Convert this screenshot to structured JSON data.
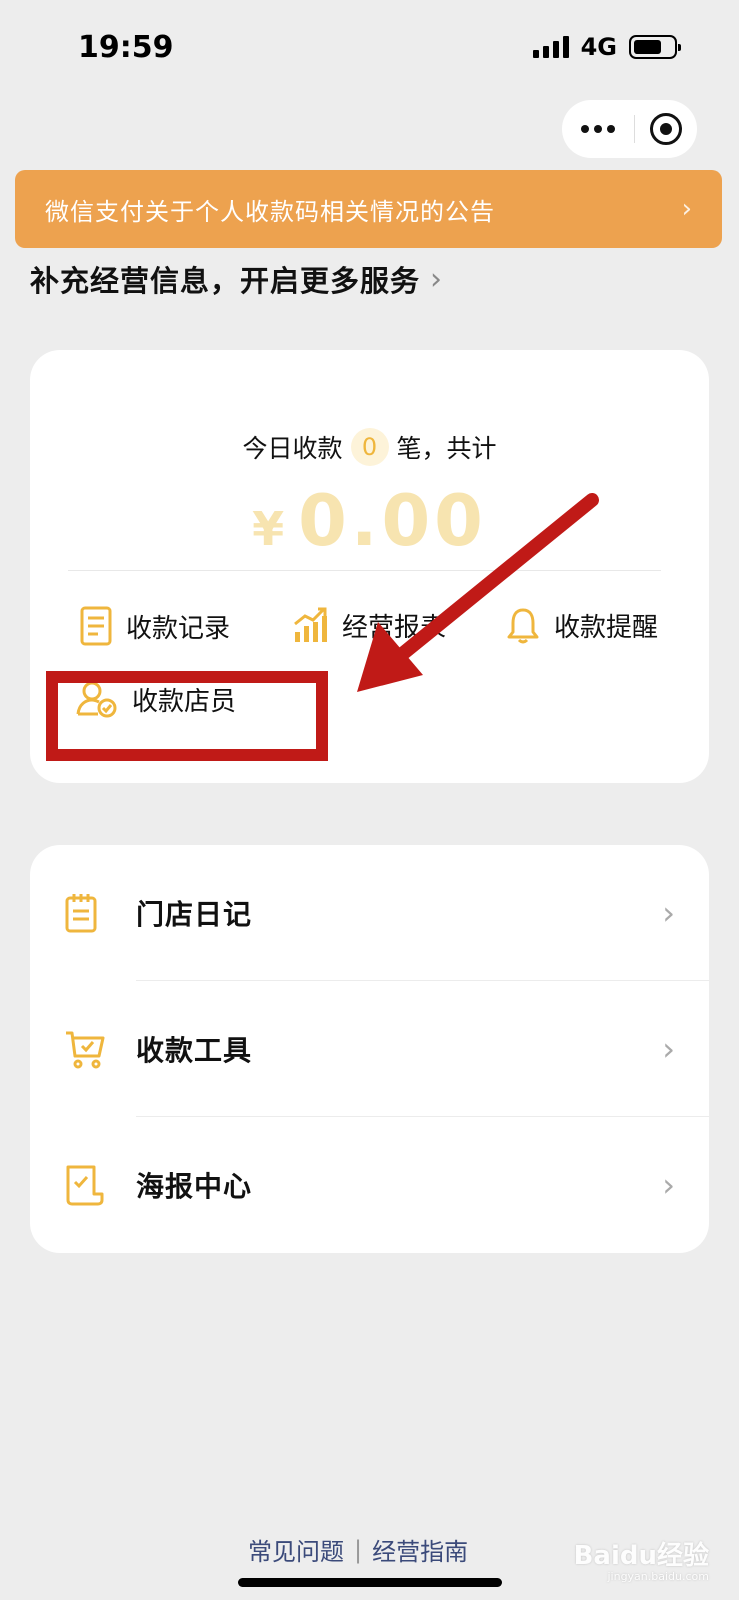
{
  "status_bar": {
    "time": "19:59",
    "network": "4G"
  },
  "notice": {
    "text": "微信支付关于个人收款码相关情况的公告",
    "chevron": "›"
  },
  "info_line": {
    "text": "补充经营信息，开启更多服务",
    "chevron": "›"
  },
  "summary": {
    "today_prefix": "今日收款",
    "count": "0",
    "today_suffix": "笔，共计",
    "currency": "¥",
    "amount": "0.00"
  },
  "quick_actions": [
    {
      "label": "收款记录",
      "icon": "document-icon"
    },
    {
      "label": "经营报表",
      "icon": "chart-icon"
    },
    {
      "label": "收款提醒",
      "icon": "bell-icon"
    },
    {
      "label": "收款店员",
      "icon": "staff-icon"
    }
  ],
  "menu": [
    {
      "label": "门店日记",
      "icon": "notepad-icon"
    },
    {
      "label": "收款工具",
      "icon": "cart-icon"
    },
    {
      "label": "海报中心",
      "icon": "poster-icon"
    }
  ],
  "footer": {
    "faq": "常见问题",
    "separator": "|",
    "guide": "经营指南"
  },
  "watermark": {
    "text": "Baidu经验",
    "sub": "jingyan.baidu.com"
  },
  "colors": {
    "accent": "#efb63d",
    "banner": "#eda24f",
    "highlight": "#c01a17",
    "background": "#ededed"
  }
}
